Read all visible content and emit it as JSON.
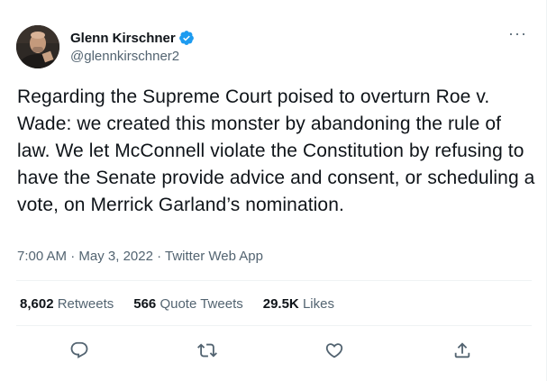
{
  "author": {
    "display_name": "Glenn Kirschner",
    "handle": "@glennkirschner2",
    "verified": true
  },
  "tweet": {
    "text": "Regarding the Supreme Court poised to overturn Roe v. Wade: we created this monster by abandoning the rule of law. We let McConnell violate the Constitution by refusing to have the Senate provide advice and consent, or scheduling a vote, on Merrick Garland’s nomination.",
    "time": "7:00 AM",
    "date": "May 3, 2022",
    "source": "Twitter Web App",
    "separator": " · "
  },
  "stats": {
    "retweets_count": "8,602",
    "retweets_label": "Retweets",
    "quotes_count": "566",
    "quotes_label": "Quote Tweets",
    "likes_count": "29.5K",
    "likes_label": "Likes"
  },
  "more_label": "···",
  "icons": {
    "more": "more-options-icon",
    "verified": "verified-badge-icon",
    "reply": "reply-icon",
    "retweet": "retweet-icon",
    "like": "like-icon",
    "share": "share-icon"
  },
  "colors": {
    "text_primary": "#0f1419",
    "text_secondary": "#536471",
    "verified_blue": "#1d9bf0",
    "divider": "#eff3f4"
  }
}
